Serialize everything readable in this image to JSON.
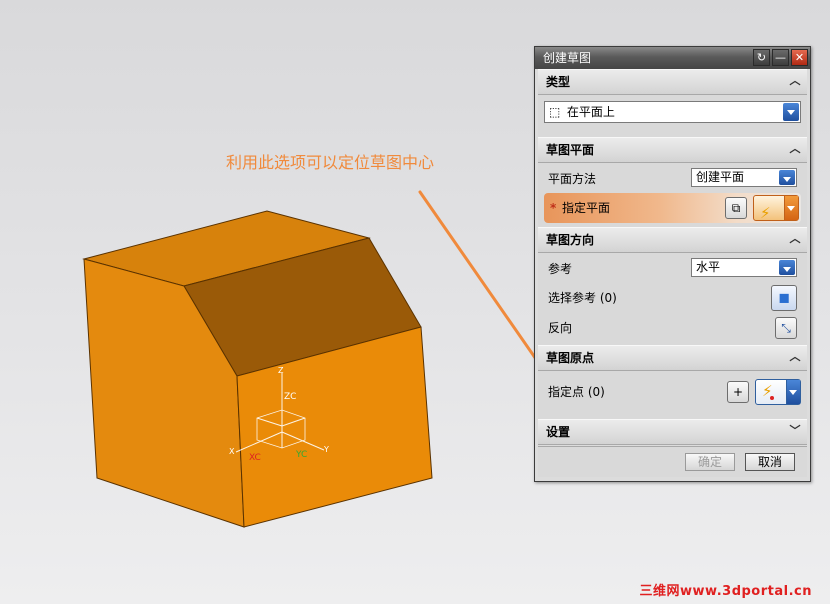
{
  "annotation": {
    "text": "利用此选项可以定位草图中心",
    "color": "#f08a3c"
  },
  "viewport": {
    "axes": {
      "zc": "ZC",
      "z": "Z",
      "xc": "XC",
      "x": "X",
      "yc": "YC",
      "y": "Y"
    },
    "solid_color": "#e48a0e"
  },
  "dialog": {
    "title": "创建草图",
    "sections": {
      "type": {
        "header": "类型",
        "selected": "在平面上"
      },
      "plane": {
        "header": "草图平面",
        "method_label": "平面方法",
        "method_value": "创建平面",
        "specify_label": "指定平面",
        "required_mark": "*"
      },
      "orientation": {
        "header": "草图方向",
        "reference_label": "参考",
        "reference_value": "水平",
        "select_ref_label": "选择参考 (0)",
        "reverse_label": "反向"
      },
      "origin": {
        "header": "草图原点",
        "specify_point_label": "指定点 (0)"
      },
      "settings": {
        "header": "设置"
      }
    },
    "buttons": {
      "ok": "确定",
      "cancel": "取消"
    }
  },
  "watermark": "三维网www.3dportal.cn"
}
